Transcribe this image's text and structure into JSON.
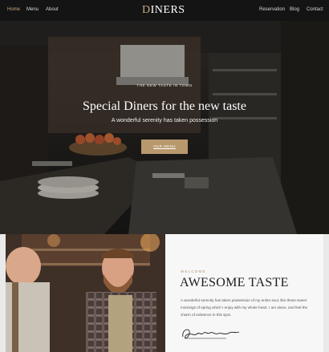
{
  "nav": {
    "left": [
      "Home",
      "Menu",
      "About"
    ],
    "right": [
      "Reservation",
      "Blog",
      "Contact"
    ],
    "logo_initial": "D",
    "logo_rest": "INERS"
  },
  "hero": {
    "eyebrow": "THE NEW TASTE IN TOWN",
    "headline": "Special Diners for the new taste",
    "subtitle": "A wonderful serenity has taken possession",
    "button": "OUR MENU"
  },
  "about": {
    "eyebrow": "WELCOME",
    "title": "AWESOME TASTE",
    "text": "A wonderful serenity has taken possession of my entire soul, like these sweet mornings of spring which I enjoy with my whole heart. I am alone, and feel the charm of existence in this spot."
  },
  "colors": {
    "accent": "#c8a97e",
    "button": "#b8986d",
    "nav_bg": "#141414"
  }
}
